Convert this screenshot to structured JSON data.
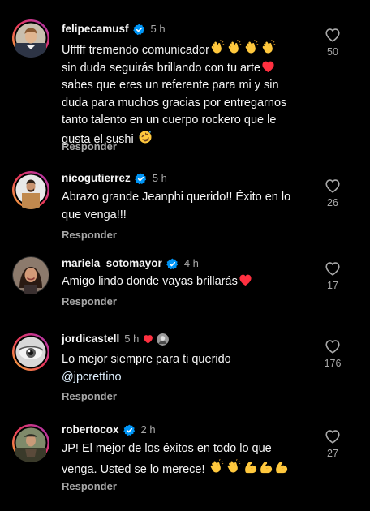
{
  "comments": [
    {
      "username": "felipecamusf",
      "time": "5 h",
      "lines": [
        "Ufffff tremendo comunicador",
        "sin duda seguirás brillando con tu arte",
        "sabes que eres un referente para mi y sin",
        "duda para muchos gracias por entregarnos",
        "tanto talento en un cuerpo rockero que le",
        "gusta el sushi"
      ],
      "reply": "Responder",
      "likes": "50"
    },
    {
      "username": "nicogutierrez",
      "time": "5 h",
      "lines": [
        "Abrazo grande Jeanphi querido!! Éxito en lo",
        "que venga!!!"
      ],
      "reply": "Responder",
      "likes": "26"
    },
    {
      "username": "mariela_sotomayor",
      "time": "4 h",
      "lines": [
        "Amigo lindo donde vayas brillarás"
      ],
      "reply": "Responder",
      "likes": "17"
    },
    {
      "username": "jordicastell",
      "time": "5 h",
      "lines": [
        "Lo mejor siempre para ti querido",
        "@jpcrettino"
      ],
      "reply": "Responder",
      "likes": "176"
    },
    {
      "username": "robertocox",
      "time": "2 h",
      "lines": [
        "JP! El mejor de los éxitos en todo lo que",
        "venga. Usted se lo merece!"
      ],
      "reply": "Responder",
      "likes": "27"
    }
  ],
  "colors": {
    "background": "#000000",
    "text": "#f5f5f5",
    "secondary": "#a8a8a8",
    "verified": "#0095f6",
    "heart_red": "#ff3040",
    "emoji_yellow": "#ffc83d"
  },
  "icons": {
    "verified": "verified-badge-icon",
    "like": "heart-outline-icon",
    "clap": "clapping-hands-emoji",
    "red_heart": "red-heart-emoji",
    "rofl": "rolling-on-floor-laughing-emoji",
    "flex": "flexed-biceps-emoji"
  }
}
